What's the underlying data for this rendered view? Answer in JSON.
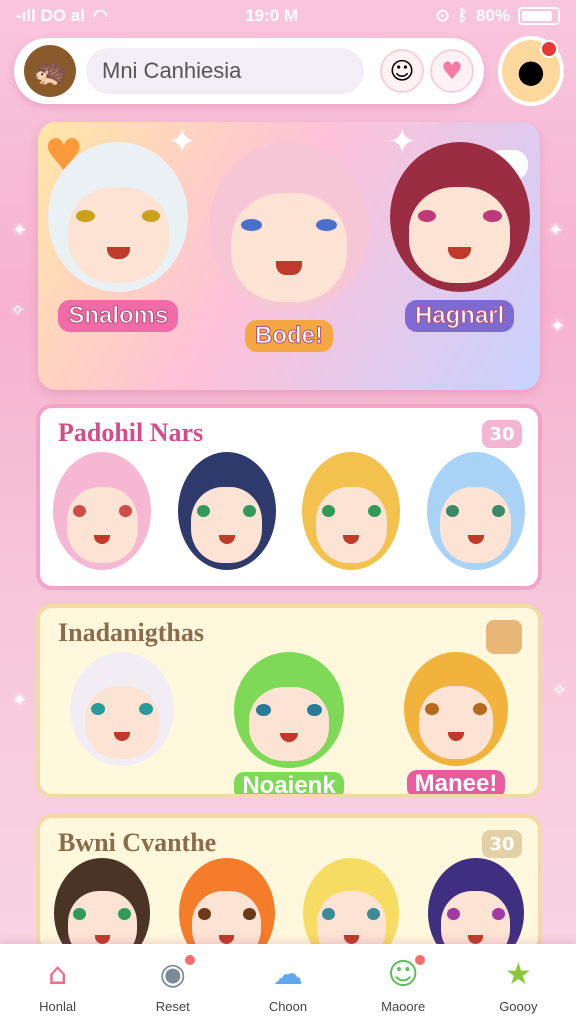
{
  "status_bar": {
    "left": "-ıll DO al",
    "time": "19:0 M",
    "right": "80%"
  },
  "search": {
    "placeholder": "Mni Canhiesia"
  },
  "hero": {
    "characters": [
      {
        "name": "Snaloms",
        "hair": "#e9f1f5",
        "label_color": "#f06ba8"
      },
      {
        "name": "Bode!",
        "hair": "#f6c6d7",
        "label_color": "#f4a742"
      },
      {
        "name": "Hagnarl",
        "hair": "#9b2d43",
        "label_color": "#7d6bd1"
      }
    ]
  },
  "sections": [
    {
      "title": "Padohil Nars",
      "count": "30",
      "characters": [
        {
          "hair": "#f6b7d2"
        },
        {
          "hair": "#2e3a6b"
        },
        {
          "hair": "#f2c14e"
        },
        {
          "hair": "#a8d3f7"
        }
      ]
    },
    {
      "title": "Inadanigthas",
      "characters": [
        {
          "hair": "#f2ecf5",
          "name": ""
        },
        {
          "hair": "#7ed957",
          "name": "Noaienk"
        },
        {
          "hair": "#f2b33d",
          "name": "Manee!"
        }
      ]
    },
    {
      "title": "Bwni Cvanthe",
      "count": "30",
      "characters": [
        {
          "hair": "#4a3426"
        },
        {
          "hair": "#f47c2a"
        },
        {
          "hair": "#f6dc62"
        },
        {
          "hair": "#3f2f80"
        }
      ]
    }
  ],
  "nav": [
    {
      "label": "Honlal",
      "icon": "home-icon",
      "symbol": "⌂",
      "badge": false
    },
    {
      "label": "Reset",
      "icon": "grill-icon",
      "symbol": "◉",
      "badge": true
    },
    {
      "label": "Choon",
      "icon": "cloud-icon",
      "symbol": "☁",
      "badge": false
    },
    {
      "label": "Maoore",
      "icon": "smiley-icon",
      "symbol": "☺",
      "badge": true
    },
    {
      "label": "Goooy",
      "icon": "star-icon",
      "symbol": "★",
      "badge": false
    }
  ]
}
